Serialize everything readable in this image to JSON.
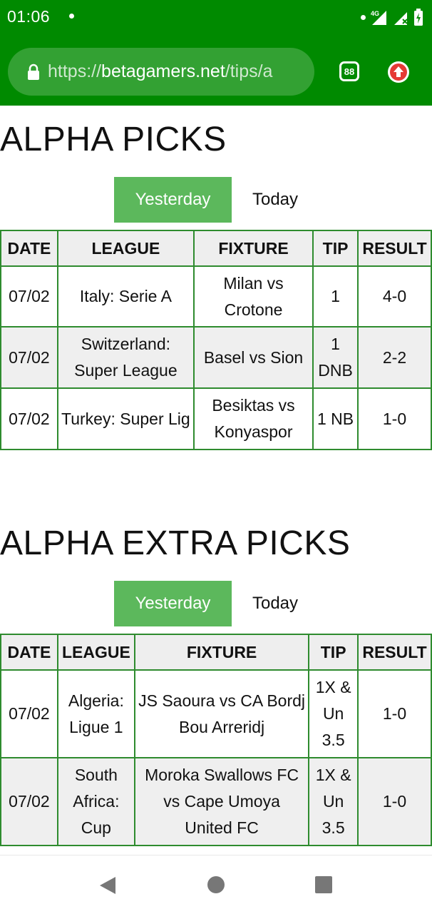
{
  "status_bar": {
    "time": "01:06",
    "network": "4G"
  },
  "browser": {
    "url_scheme": "https://",
    "url_host": "betagamers.net",
    "url_path": "/tips/a",
    "tab_count": "88"
  },
  "sections": [
    {
      "title": "ALPHA PICKS",
      "tabs": [
        "Yesterday",
        "Today"
      ],
      "columns": [
        "DATE",
        "LEAGUE",
        "FIXTURE",
        "TIP",
        "RESULT"
      ],
      "rows": [
        {
          "date": "07/02",
          "league": "Italy: Serie A",
          "fixture": "Milan vs Crotone",
          "tip": "1",
          "result": "4-0"
        },
        {
          "date": "07/02",
          "league": "Switzerland: Super League",
          "fixture": "Basel vs Sion",
          "tip": "1 DNB",
          "result": "2-2"
        },
        {
          "date": "07/02",
          "league": "Turkey: Super Lig",
          "fixture": "Besiktas vs Konyaspor",
          "tip": "1 NB",
          "result": "1-0"
        }
      ]
    },
    {
      "title": "ALPHA EXTRA PICKS",
      "tabs": [
        "Yesterday",
        "Today"
      ],
      "columns": [
        "DATE",
        "LEAGUE",
        "FIXTURE",
        "TIP",
        "RESULT"
      ],
      "rows": [
        {
          "date": "07/02",
          "league": "Algeria: Ligue 1",
          "fixture": "JS Saoura vs CA Bordj Bou Arreridj",
          "tip": "1X & Un 3.5",
          "result": "1-0"
        },
        {
          "date": "07/02",
          "league": "South Africa: Cup",
          "fixture": "Moroka Swallows FC vs Cape Umoya United FC",
          "tip": "1X & Un 3.5",
          "result": "1-0"
        }
      ]
    }
  ],
  "colors": {
    "bar_green": "#008a00",
    "tab_active": "#5cb85c",
    "table_border": "#2e8b2e"
  },
  "icons": {
    "lock": "lock-icon",
    "tabs": "tab-switcher-icon",
    "update": "update-arrow-icon",
    "back": "back-icon",
    "home": "home-icon",
    "recents": "recents-icon"
  }
}
